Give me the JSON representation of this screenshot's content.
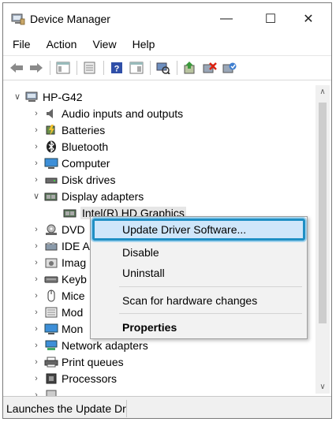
{
  "window": {
    "title": "Device Manager",
    "controls": {
      "minimize": "—",
      "maximize": "☐",
      "close": "✕"
    }
  },
  "menubar": [
    "File",
    "Action",
    "View",
    "Help"
  ],
  "toolbar": {
    "buttons": [
      "back-arrow-icon",
      "forward-arrow-icon",
      "properties-panel-icon",
      "console-tree-icon",
      "help-icon",
      "action-pane-icon",
      "scan-hardware-icon",
      "update-driver-icon",
      "uninstall-device-icon",
      "enable-device-icon"
    ]
  },
  "tree": {
    "root": "HP-G42",
    "items": [
      {
        "label": "Audio inputs and outputs",
        "icon": "speaker-icon"
      },
      {
        "label": "Batteries",
        "icon": "battery-icon"
      },
      {
        "label": "Bluetooth",
        "icon": "bluetooth-icon"
      },
      {
        "label": "Computer",
        "icon": "computer-icon"
      },
      {
        "label": "Disk drives",
        "icon": "disk-drive-icon"
      },
      {
        "label": "Display adapters",
        "icon": "display-adapter-icon",
        "expanded": true
      },
      {
        "label": "Intel(R) HD Graphics",
        "icon": "display-adapter-icon",
        "child": true,
        "selected": true
      },
      {
        "label": "DVD",
        "icon": "dvd-drive-icon"
      },
      {
        "label": "IDE A",
        "icon": "ide-controller-icon"
      },
      {
        "label": "Imag",
        "icon": "imaging-device-icon"
      },
      {
        "label": "Keyb",
        "icon": "keyboard-icon"
      },
      {
        "label": "Mice",
        "icon": "mouse-icon"
      },
      {
        "label": "Mod",
        "icon": "modem-icon"
      },
      {
        "label": "Mon",
        "icon": "monitor-icon"
      },
      {
        "label": "Network adapters",
        "icon": "network-adapter-icon"
      },
      {
        "label": "Print queues",
        "icon": "printer-icon"
      },
      {
        "label": "Processors",
        "icon": "processor-icon"
      }
    ]
  },
  "context_menu": {
    "items": [
      {
        "label": "Update Driver Software...",
        "highlighted": true
      },
      {
        "label": "Disable"
      },
      {
        "label": "Uninstall"
      },
      {
        "label": "Scan for hardware changes"
      },
      {
        "label": "Properties",
        "bold": true
      }
    ]
  },
  "statusbar": {
    "text": "Launches the Update Dr"
  },
  "colors": {
    "highlight_border": "#1f8fc4",
    "highlight_fill": "#cfe6fa",
    "menu_bg": "#f2f2f2"
  }
}
